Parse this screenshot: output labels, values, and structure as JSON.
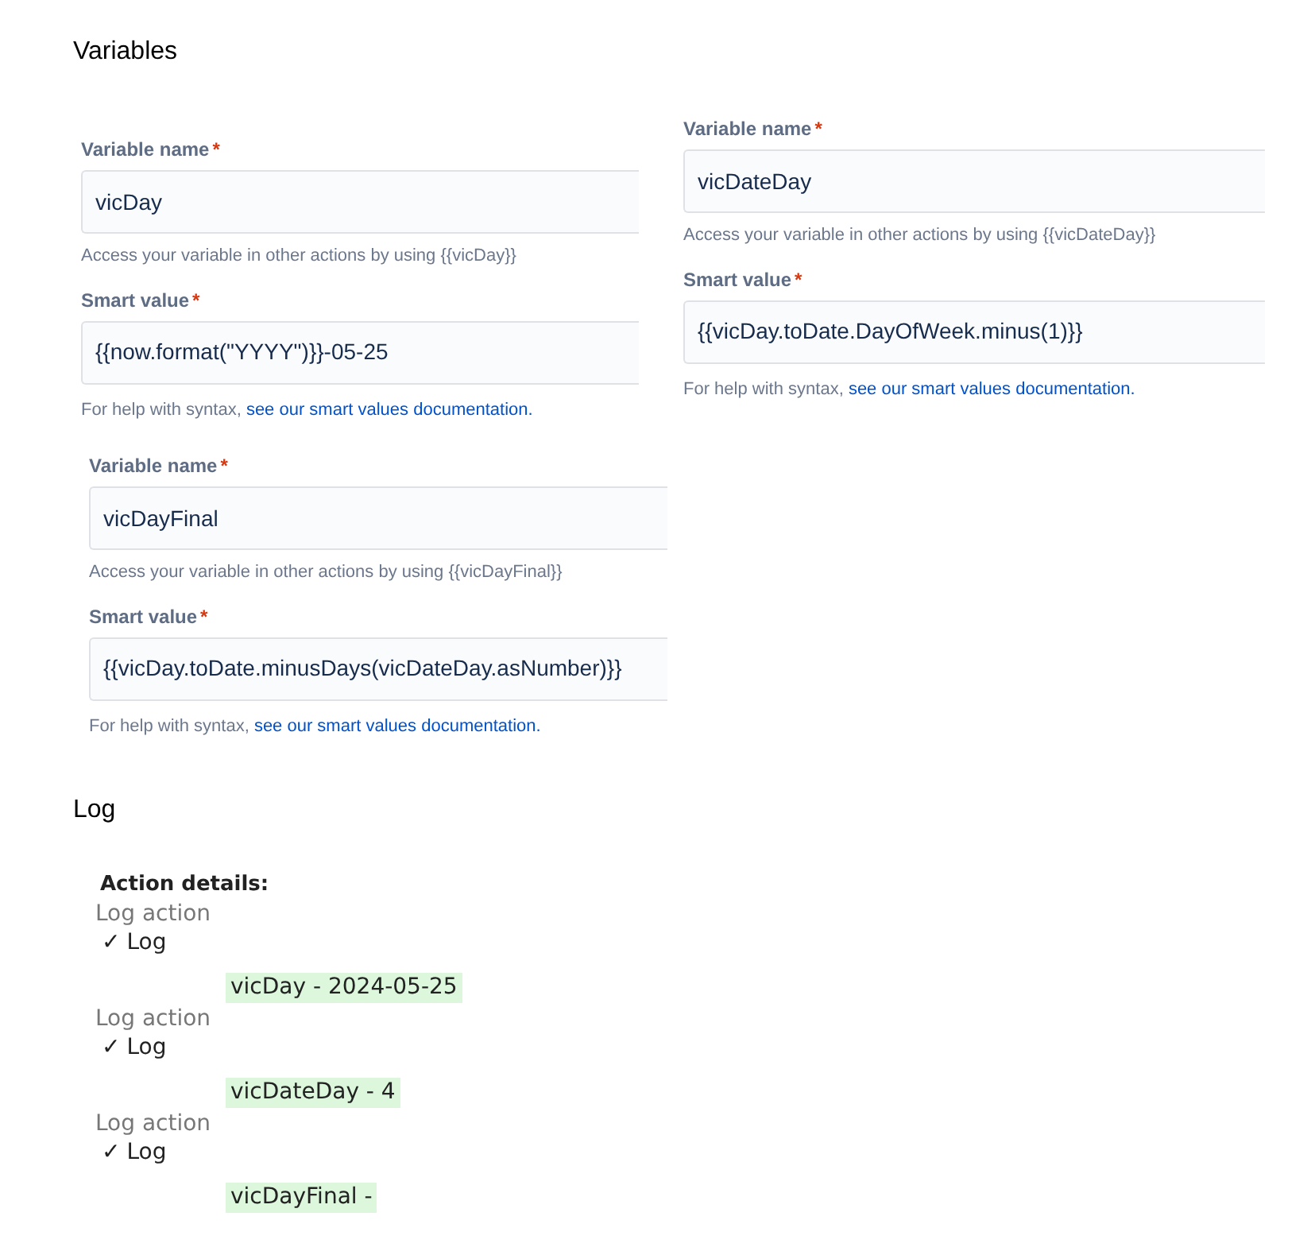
{
  "variables_heading": "Variables",
  "forms": [
    {
      "name_label": "Variable name",
      "name_required": "*",
      "name_value": "vicDay",
      "name_help": "Access your variable in other actions by using {{vicDay}}",
      "smart_label": "Smart value",
      "smart_required": "*",
      "smart_value": "{{now.format(\"YYYY\")}}-05-25",
      "smart_help": "For help with syntax, ",
      "smart_link": "see our smart values documentation."
    },
    {
      "name_label": "Variable name",
      "name_required": "*",
      "name_value": "vicDateDay",
      "name_help": "Access your variable in other actions by using {{vicDateDay}}",
      "smart_label": "Smart value",
      "smart_required": "*",
      "smart_value": "{{vicDay.toDate.DayOfWeek.minus(1)}}",
      "smart_help": "For help with syntax, ",
      "smart_link": "see our smart values documentation."
    },
    {
      "name_label": "Variable name",
      "name_required": "*",
      "name_value": "vicDayFinal",
      "name_help": "Access your variable in other actions by using {{vicDayFinal}}",
      "smart_label": "Smart value",
      "smart_required": "*",
      "smart_value": "{{vicDay.toDate.minusDays(vicDateDay.asNumber)}}",
      "smart_help": "For help with syntax, ",
      "smart_link": "see our smart values documentation."
    }
  ],
  "log_heading": "Log",
  "log": {
    "title": "Action details:",
    "entries": [
      {
        "action": "Log action",
        "check": "✓",
        "name": "Log",
        "message": "vicDay - 2024-05-25"
      },
      {
        "action": "Log action",
        "check": "✓",
        "name": "Log",
        "message": "vicDateDay - 4"
      },
      {
        "action": "Log action",
        "check": "✓",
        "name": "Log",
        "message": "vicDayFinal -"
      }
    ]
  }
}
